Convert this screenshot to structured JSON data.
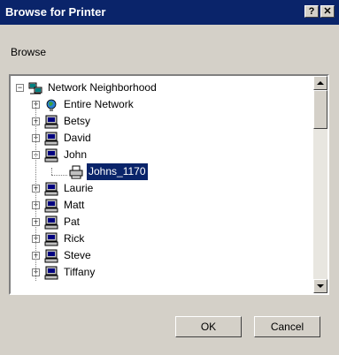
{
  "window": {
    "title": "Browse for Printer",
    "help_glyph": "?",
    "close_glyph": "✕"
  },
  "prompt_label": "Browse",
  "tree": {
    "root": "Network Neighborhood",
    "entire_network": "Entire Network",
    "computers": [
      "Betsy",
      "David",
      "John",
      "Laurie",
      "Matt",
      "Pat",
      "Rick",
      "Steve",
      "Tiffany"
    ],
    "expanded_computer": "John",
    "printer": "Johns_1170",
    "selected": "Johns_1170"
  },
  "buttons": {
    "ok": "OK",
    "cancel": "Cancel"
  },
  "icons": [
    "question-icon",
    "close-icon",
    "network-icon",
    "globe-icon",
    "computer-icon",
    "printer-icon",
    "scroll-up-icon",
    "scroll-down-icon"
  ],
  "colors": {
    "titlebar": "#0a246a",
    "dialog_face": "#d4d0c8",
    "selection": "#0a246a"
  }
}
